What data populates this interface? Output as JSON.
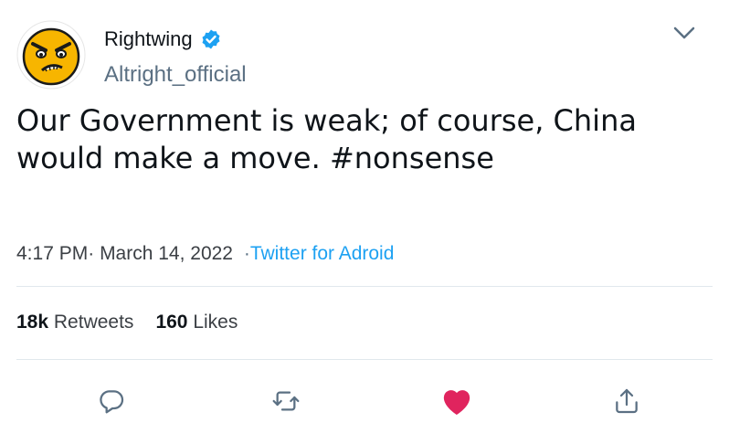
{
  "user": {
    "display_name": "Rightwing",
    "handle": "Altright_official",
    "avatar_icon": "angry-face-icon",
    "verified_icon": "verified-badge-icon"
  },
  "menu_icon": "chevron-down-icon",
  "tweet": {
    "text": "Our Government is weak; of course, China would make a move. #nonsense"
  },
  "meta": {
    "time": "4:17 PM",
    "date": "March 14, 2022",
    "separator": "·",
    "source": "Twitter for Adroid"
  },
  "stats": {
    "retweets_count": "18k",
    "retweets_label": "Retweets",
    "likes_count": "160",
    "likes_label": "Likes"
  },
  "actions": [
    {
      "icon": "reply-icon"
    },
    {
      "icon": "retweet-icon"
    },
    {
      "icon": "like-icon",
      "color": "#e0245e",
      "active": true
    },
    {
      "icon": "share-icon"
    }
  ],
  "colors": {
    "accent": "#1da1f2",
    "muted": "#5b7083",
    "like": "#e0245e",
    "avatar_face": "#f7b500"
  }
}
